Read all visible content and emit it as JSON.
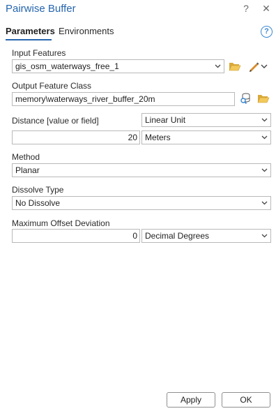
{
  "window": {
    "title": "Pairwise Buffer",
    "help_glyph": "?",
    "close_glyph": "✕"
  },
  "tabs": [
    {
      "label": "Parameters",
      "active": true
    },
    {
      "label": "Environments",
      "active": false
    }
  ],
  "help_icon_glyph": "?",
  "params": {
    "input_features": {
      "label": "Input Features",
      "value": "gis_osm_waterways_free_1"
    },
    "output_feature_class": {
      "label": "Output Feature Class",
      "value": "memory\\waterways_river_buffer_20m"
    },
    "distance": {
      "label": "Distance [value or field]",
      "type_value": "Linear Unit",
      "value": "20",
      "unit": "Meters"
    },
    "method": {
      "label": "Method",
      "value": "Planar"
    },
    "dissolve_type": {
      "label": "Dissolve Type",
      "value": "No Dissolve"
    },
    "max_offset_deviation": {
      "label": "Maximum Offset Deviation",
      "value": "0",
      "unit": "Decimal Degrees"
    }
  },
  "buttons": {
    "apply": "Apply",
    "ok": "OK"
  },
  "colors": {
    "accent": "#2565ae",
    "folder": "#e8b84a",
    "help": "#3a87d0"
  }
}
